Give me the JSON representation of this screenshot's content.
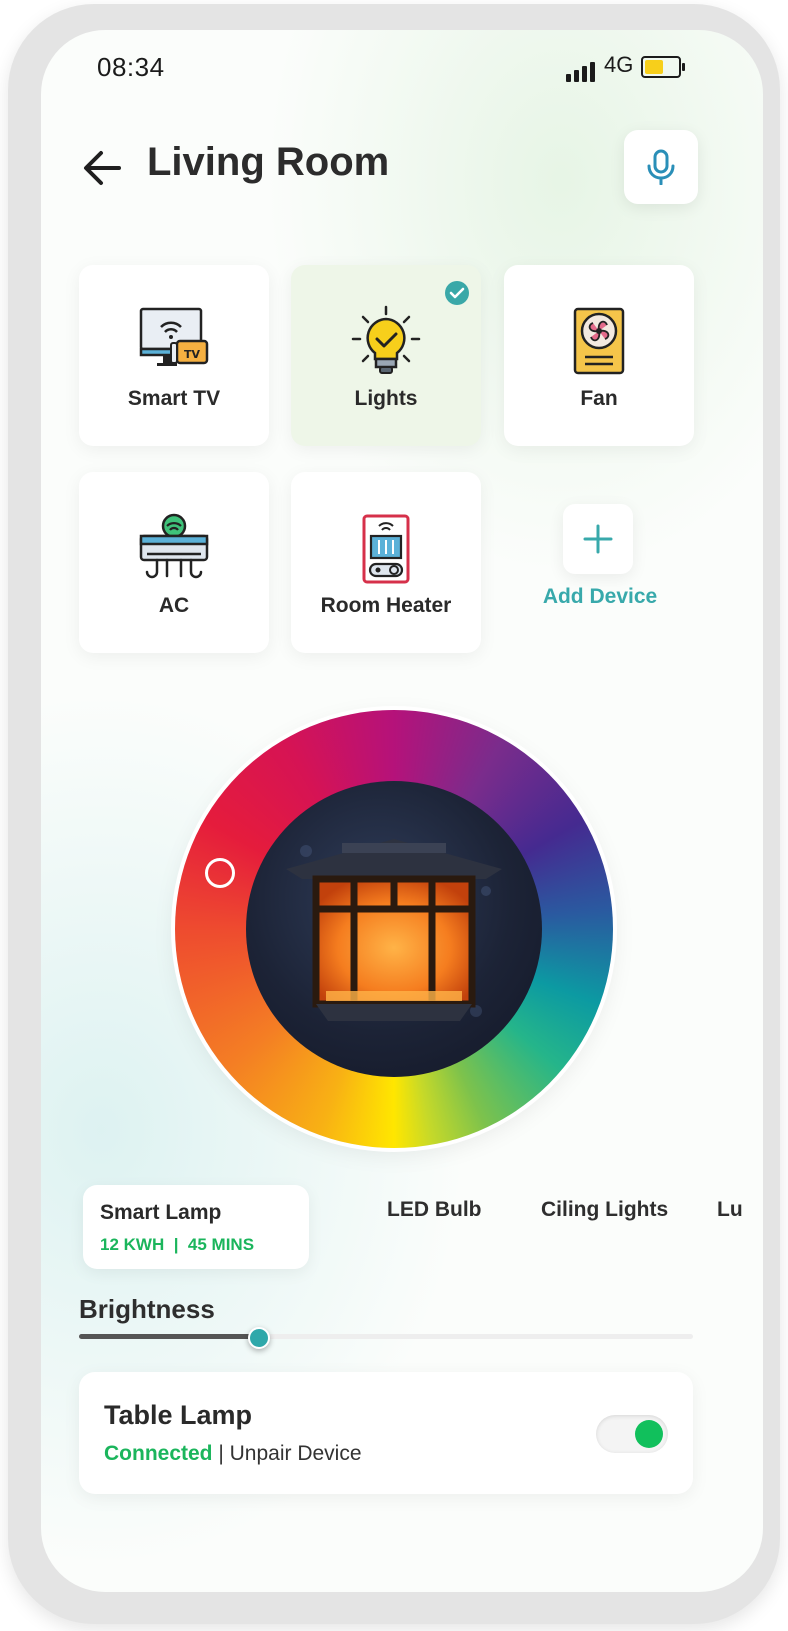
{
  "status_bar": {
    "time": "08:34",
    "network": "4G"
  },
  "header": {
    "title": "Living Room"
  },
  "devices": [
    {
      "label": "Smart TV",
      "icon": "smart-tv-icon",
      "selected": false
    },
    {
      "label": "Lights",
      "icon": "light-bulb-icon",
      "selected": true
    },
    {
      "label": "Fan",
      "icon": "fan-icon",
      "selected": false
    },
    {
      "label": "AC",
      "icon": "air-conditioner-icon",
      "selected": false
    },
    {
      "label": "Room Heater",
      "icon": "room-heater-icon",
      "selected": false
    }
  ],
  "add_device": {
    "label": "Add Device"
  },
  "light_control": {
    "tabs": [
      "Smart Lamp",
      "LED Bulb",
      "Ciling Lights",
      "Lu"
    ],
    "active_tab": {
      "name": "Smart Lamp",
      "energy": "12 KWH",
      "separator": "|",
      "time": "45 MINS"
    }
  },
  "brightness": {
    "label": "Brightness",
    "value": 0.29
  },
  "lamp_card": {
    "title": "Table Lamp",
    "status": "Connected",
    "separator": " | ",
    "action": "Unpair Device",
    "toggle_on": true
  },
  "colors": {
    "accent": "#38a9ab",
    "success": "#1bb55c",
    "active_card": "#eef6e8"
  }
}
